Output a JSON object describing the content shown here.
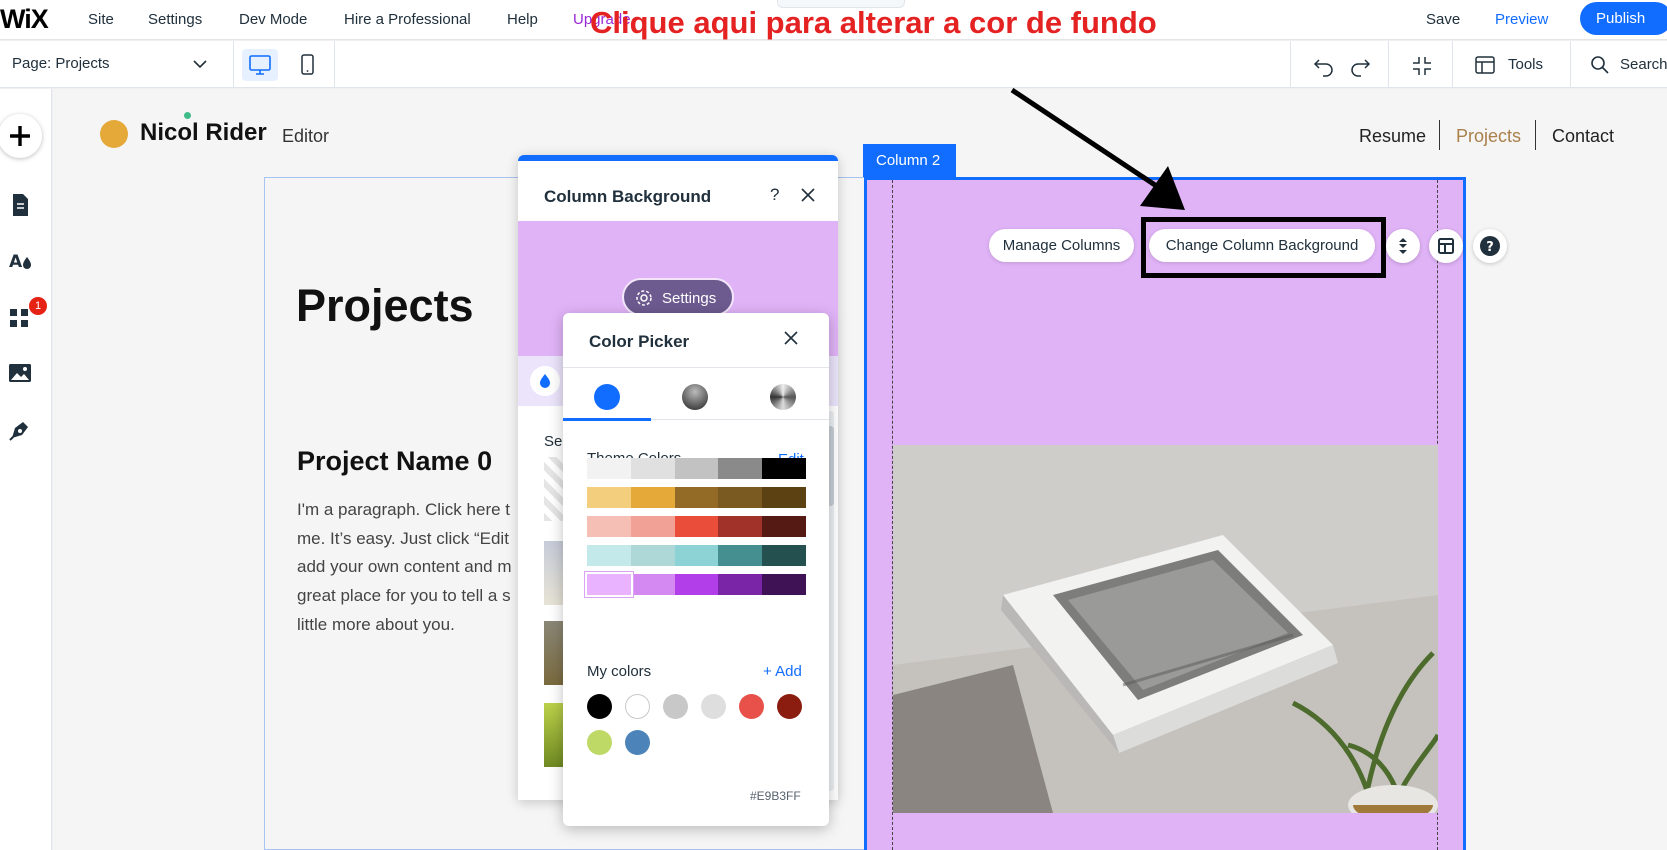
{
  "topbar": {
    "logo": "WiX",
    "menu": [
      "Site",
      "Settings",
      "Dev Mode",
      "Hire a Professional",
      "Help",
      "Upgrade"
    ],
    "save": "Save",
    "preview": "Preview",
    "publish": "Publish"
  },
  "toolbar": {
    "page_select": "Page: Projects",
    "tools": "Tools",
    "search": "Search"
  },
  "annotation": {
    "text": "Clique aqui para alterar a cor de fundo"
  },
  "sidebar": {
    "items": [
      "add-icon",
      "pages-icon",
      "design-icon",
      "apps-icon",
      "media-icon",
      "pen-icon"
    ],
    "apps_badge": "1"
  },
  "site": {
    "name": "Nicol Rider",
    "role": "Editor",
    "nav": [
      "Resume",
      "Projects",
      "Contact"
    ],
    "title": "Projects",
    "project_name": "Project Name 0",
    "paragraph_lines": [
      "I'm a paragraph. Click here t",
      "me. It’s easy. Just click “Edit",
      "add your own content and m",
      "great place for you to tell a s",
      "little more about you."
    ]
  },
  "column": {
    "tag": "Column 2",
    "manage_columns": "Manage Columns",
    "change_background": "Change Column Background",
    "background_color": "#E0B3F7"
  },
  "column_background_panel": {
    "title": "Column Background",
    "help": "?",
    "settings": "Settings",
    "section_label": "Se"
  },
  "color_picker": {
    "title": "Color Picker",
    "theme_colors_label": "Theme Colors",
    "edit": "Edit",
    "theme_rows": [
      [
        "#F2F2F2",
        "#E0E0E0",
        "#C2C2C2",
        "#8A8A8A",
        "#000000"
      ],
      [
        "#F3CE7C",
        "#E5A93A",
        "#936B26",
        "#7A5A20",
        "#5C4212"
      ],
      [
        "#F6BFB6",
        "#F2A197",
        "#EA4E3B",
        "#A0322A",
        "#551A14"
      ],
      [
        "#C3E9EA",
        "#AED7D8",
        "#8DD3D6",
        "#468F91",
        "#24504F"
      ],
      [
        "#E9B3FF",
        "#D389F1",
        "#B23EEA",
        "#7A24A8",
        "#3E1255"
      ]
    ],
    "my_colors_label": "My colors",
    "add": "+ Add",
    "my_colors": [
      "#000000",
      "#FFFFFF",
      "#C8C8C8",
      "#DEDEDE",
      "#E8504A",
      "#8A1C10",
      "#BED966",
      "#4C83B8"
    ],
    "hex": "#E9B3FF"
  }
}
